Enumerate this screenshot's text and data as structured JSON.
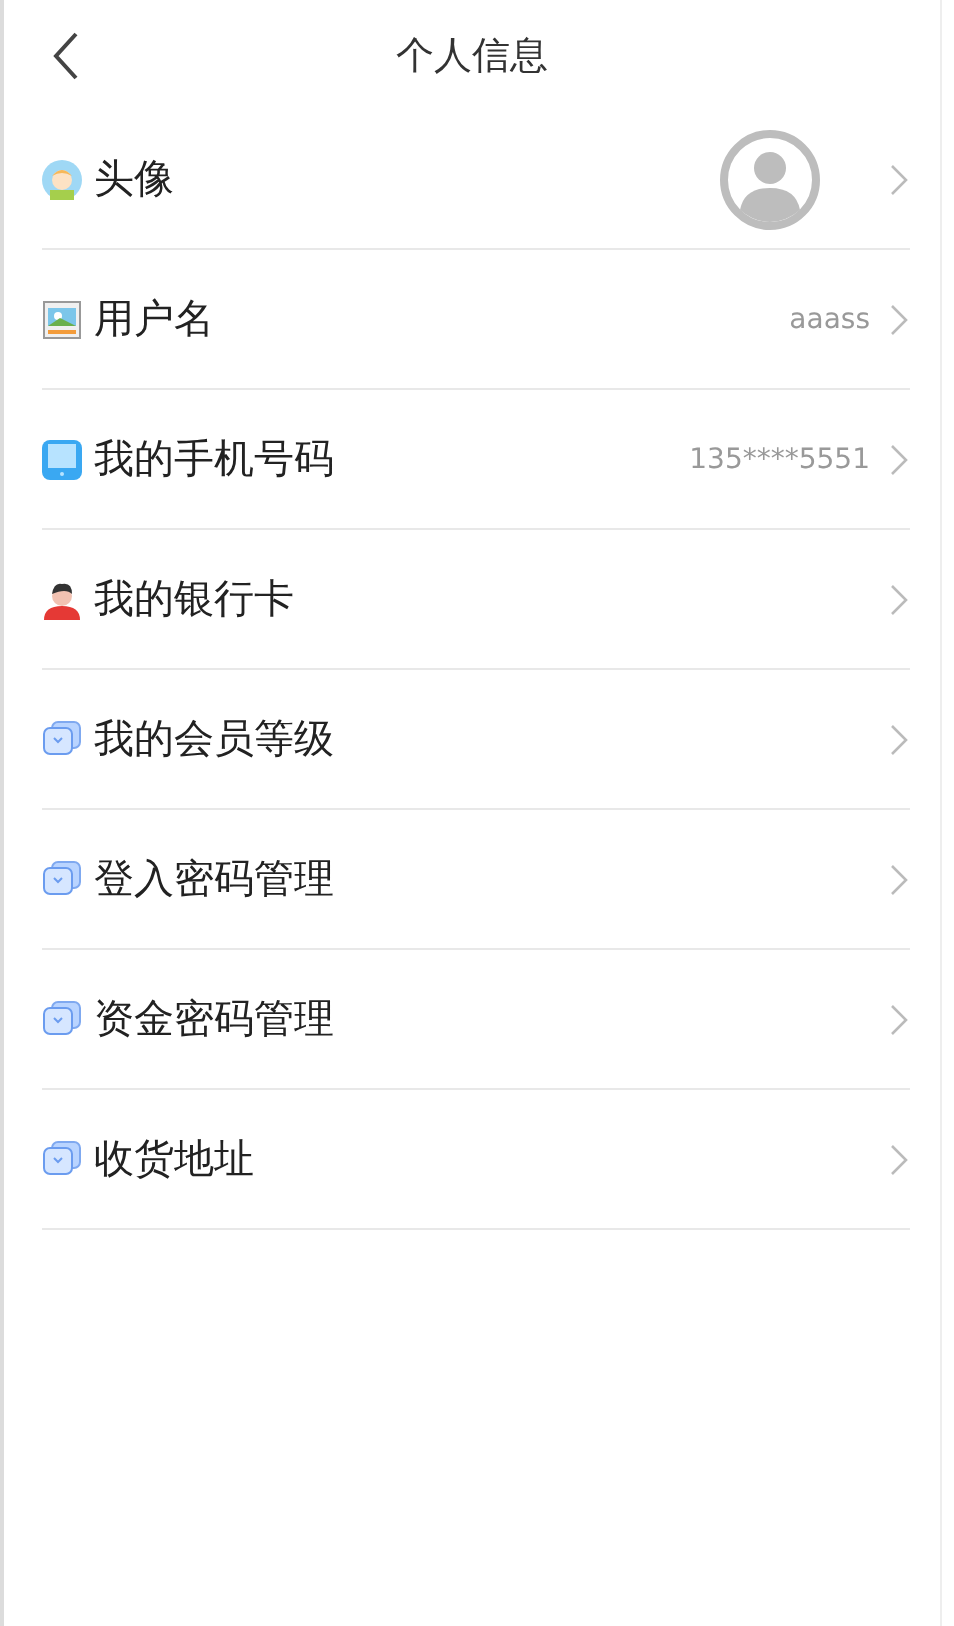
{
  "header": {
    "title": "个人信息"
  },
  "rows": [
    {
      "label": "头像",
      "kind": "avatar"
    },
    {
      "label": "用户名",
      "kind": "text",
      "value": "aaass"
    },
    {
      "label": "我的手机号码",
      "kind": "text",
      "value": "135****5551"
    },
    {
      "label": "我的银行卡",
      "kind": "text"
    },
    {
      "label": "我的会员等级",
      "kind": "text"
    },
    {
      "label": "登入密码管理",
      "kind": "text"
    },
    {
      "label": "资金密码管理",
      "kind": "text"
    },
    {
      "label": "收货地址",
      "kind": "text"
    }
  ]
}
